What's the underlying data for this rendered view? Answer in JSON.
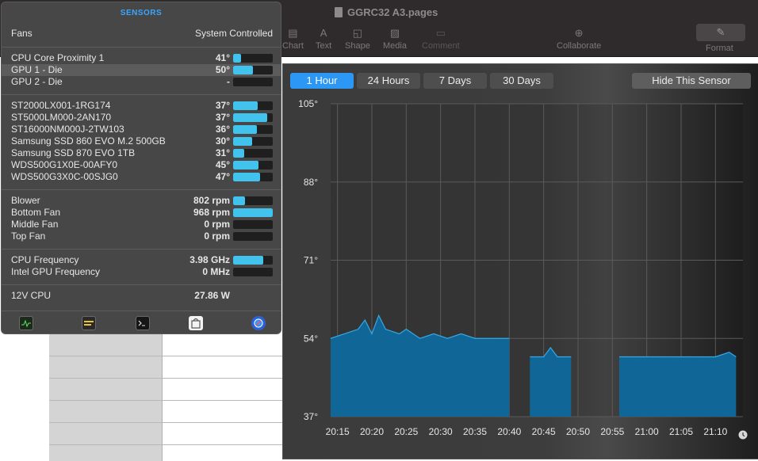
{
  "pages": {
    "doc_title": "GGRC32 A3.pages",
    "toolbar": [
      {
        "label": "Chart",
        "glyph": "▤",
        "x": 356,
        "dim": false
      },
      {
        "label": "Text",
        "glyph": "A",
        "x": 398,
        "dim": false
      },
      {
        "label": "Shape",
        "glyph": "◱",
        "x": 435,
        "dim": false
      },
      {
        "label": "Media",
        "glyph": "▨",
        "x": 483,
        "dim": false
      },
      {
        "label": "Comment",
        "glyph": "▭",
        "x": 532,
        "dim": true
      },
      {
        "label": "Collaborate",
        "glyph": "⊕",
        "x": 702,
        "dim": false
      }
    ],
    "format_label": "Format",
    "format_glyph": "✎"
  },
  "sensors": {
    "title": "SENSORS",
    "fans_label": "Fans",
    "fans_mode": "System Controlled",
    "groups": [
      {
        "rows": [
          {
            "name": "CPU Core Proximity 1",
            "value": "41°",
            "level": 0.2
          },
          {
            "name": "GPU 1 - Die",
            "value": "50°",
            "level": 0.5,
            "selected": true
          },
          {
            "name": "GPU 2 - Die",
            "value": "-",
            "level": 0
          }
        ]
      },
      {
        "rows": [
          {
            "name": "ST2000LX001-1RG174",
            "value": "37°",
            "level": 0.62
          },
          {
            "name": "ST5000LM000-2AN170",
            "value": "37°",
            "level": 0.86
          },
          {
            "name": "ST16000NM000J-2TW103",
            "value": "36°",
            "level": 0.6
          },
          {
            "name": "Samsung SSD 860 EVO M.2 500GB",
            "value": "30°",
            "level": 0.48
          },
          {
            "name": "Samsung SSD 870 EVO 1TB",
            "value": "31°",
            "level": 0.28
          },
          {
            "name": "WDS500G1X0E-00AFY0",
            "value": "45°",
            "level": 0.64
          },
          {
            "name": "WDS500G3X0C-00SJG0",
            "value": "47°",
            "level": 0.68
          }
        ]
      },
      {
        "rows": [
          {
            "name": "Blower",
            "value": "802 rpm",
            "level": 0.3
          },
          {
            "name": "Bottom Fan",
            "value": "968 rpm",
            "level": 1.0
          },
          {
            "name": "Middle Fan",
            "value": "0 rpm",
            "level": 0
          },
          {
            "name": "Top Fan",
            "value": "0 rpm",
            "level": 0
          }
        ]
      },
      {
        "rows": [
          {
            "name": "CPU Frequency",
            "value": "3.98 GHz",
            "level": 0.76
          },
          {
            "name": "Intel GPU Frequency",
            "value": "0 MHz",
            "level": 0
          }
        ]
      },
      {
        "rows": [
          {
            "name": "12V CPU",
            "value": "27.86 W",
            "level": null
          }
        ]
      }
    ],
    "footer_icons": [
      "activity-monitor-icon",
      "console-icon",
      "terminal-icon",
      "app-store-icon",
      "safari-icon"
    ]
  },
  "chart_panel": {
    "ranges": [
      {
        "label": "1 Hour",
        "active": true
      },
      {
        "label": "24 Hours",
        "active": false
      },
      {
        "label": "7 Days",
        "active": false
      },
      {
        "label": "30 Days",
        "active": false
      }
    ],
    "hide_label": "Hide This Sensor",
    "colors": {
      "fill": "#0f6697",
      "line": "#35a9e2",
      "grid": "#5a5a5a",
      "text": "#e6e6e6"
    }
  },
  "chart_data": {
    "type": "area",
    "title": "",
    "xlabel": "",
    "ylabel": "",
    "ylim": [
      37,
      105
    ],
    "yticks": [
      "105°",
      "88°",
      "71°",
      "54°",
      "37°"
    ],
    "ytick_values": [
      105,
      88,
      71,
      54,
      37
    ],
    "xticks": [
      "20:15",
      "20:20",
      "20:25",
      "20:30",
      "20:35",
      "20:40",
      "20:45",
      "20:50",
      "20:55",
      "21:00",
      "21:05",
      "21:10"
    ],
    "xlim": [
      "20:14",
      "21:14"
    ],
    "series": [
      {
        "segment": 1,
        "x": [
          "20:14",
          "20:16",
          "20:18",
          "20:19",
          "20:20",
          "20:21",
          "20:22",
          "20:24",
          "20:25",
          "20:27",
          "20:29",
          "20:31",
          "20:33",
          "20:35",
          "20:37",
          "20:39",
          "20:40"
        ],
        "values": [
          54,
          55,
          56,
          58,
          55,
          59,
          56,
          55,
          56,
          54,
          55,
          54,
          55,
          54,
          54,
          54,
          54
        ]
      },
      {
        "segment": 2,
        "x": [
          "20:43",
          "20:45",
          "20:46",
          "20:47",
          "20:48",
          "20:49"
        ],
        "values": [
          50,
          50,
          52,
          50,
          50,
          50
        ]
      },
      {
        "segment": 3,
        "x": [
          "20:56",
          "20:58",
          "21:00",
          "21:02",
          "21:04",
          "21:06",
          "21:08",
          "21:10",
          "21:12",
          "21:13"
        ],
        "values": [
          50,
          50,
          50,
          50,
          50,
          50,
          50,
          50,
          51,
          50
        ]
      }
    ],
    "grid": true
  }
}
